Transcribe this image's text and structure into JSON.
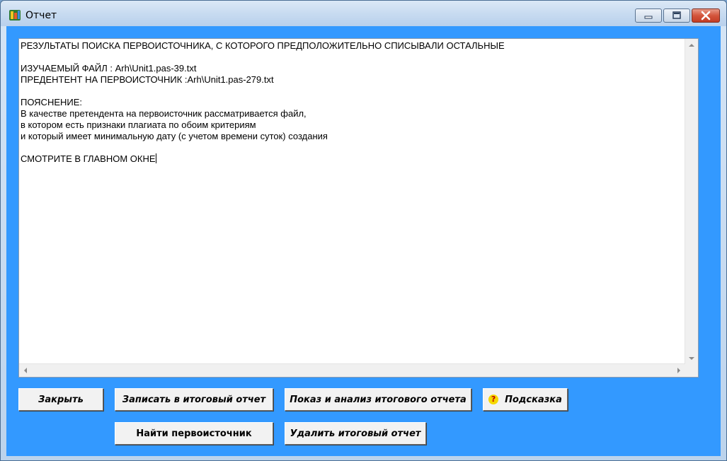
{
  "window": {
    "title": "Отчет",
    "icon": "app-icon",
    "controls": {
      "minimize": "minimize-icon",
      "maximize": "maximize-icon",
      "close": "close-icon"
    }
  },
  "report": {
    "text": "РЕЗУЛЬТАТЫ ПОИСКА ПЕРВОИСТОЧНИКА, С КОТОРОГО ПРЕДПОЛОЖИТЕЛЬНО СПИСЫВАЛИ ОСТАЛЬНЫЕ\n\nИЗУЧАЕМЫЙ ФАЙЛ : Arh\\Unit1.pas-39.txt\nПРЕДЕНТЕНТ НА ПЕРВОИСТОЧНИК :Arh\\Unit1.pas-279.txt\n\nПОЯСНЕНИЕ:\nВ качестве претендента на первоисточник рассматривается файл,\nв котором есть признаки плагиата по обоим критериям\nи который имеет минимальную дату (с учетом времени суток) создания\n\nСМОТРИТЕ В ГЛАВНОМ ОКНЕ"
  },
  "buttons": {
    "close": "Закрыть",
    "save_to_report": "Записать в итоговый отчет",
    "show_analysis": "Показ и анализ итогового  отчета",
    "hint": "Подсказка",
    "hint_icon": "?",
    "find_source": "Найти первоисточник",
    "delete_report": "Удалить итоговый отчет"
  },
  "colors": {
    "client_background": "#3399ff",
    "button_face": "#f2f2f2",
    "close_button": "#c33d24"
  }
}
